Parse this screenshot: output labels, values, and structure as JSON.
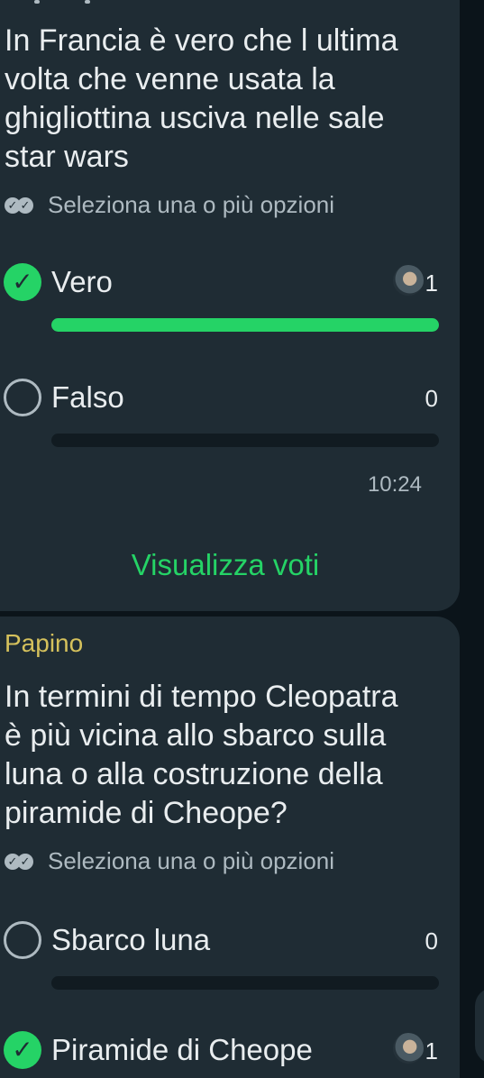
{
  "poll1": {
    "question": "In Francia è vero che l ultima\nvolta che venne usata la\nghigliottina usciva nelle sale\nstar wars",
    "hint": "Seleziona una o più opzioni",
    "options": [
      {
        "label": "Vero",
        "count": "1",
        "selected": true,
        "fraction": 1.0
      },
      {
        "label": "Falso",
        "count": "0",
        "selected": false,
        "fraction": 0.0
      }
    ],
    "time": "10:24",
    "view_votes": "Visualizza voti"
  },
  "poll2": {
    "sender": "Papino",
    "question": "In termini di tempo Cleopatra\nè più vicina allo sbarco sulla\nluna o alla costruzione della\npiramide di Cheope?",
    "hint": "Seleziona una o più opzioni",
    "options": [
      {
        "label": "Sbarco luna",
        "count": "0",
        "selected": false,
        "fraction": 0.0
      },
      {
        "label": "Piramide di Cheope",
        "count": "1",
        "selected": true,
        "fraction": 1.0
      }
    ]
  },
  "colors": {
    "accent": "#25d366",
    "bubble": "#1f2c34",
    "background": "#0b141a",
    "sender": "#d5c15c"
  }
}
